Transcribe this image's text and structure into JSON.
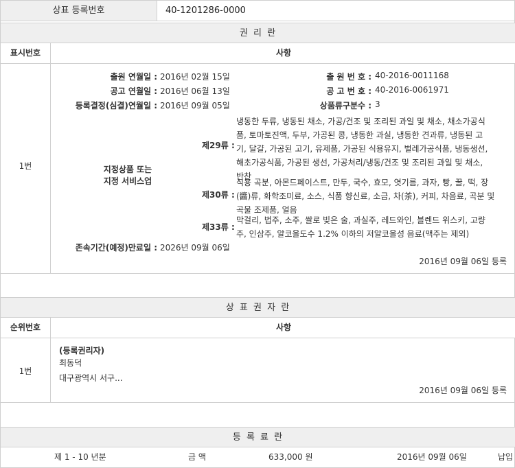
{
  "header": {
    "reg_label": "상표 등록번호",
    "reg_number": "40-1201286-0000"
  },
  "rights_section": {
    "title": "권 리 란",
    "col_number": "표시번호",
    "col_matters": "사항",
    "row_number": "1번",
    "filing_date_label": "출원 연월일 :",
    "filing_date": "2016년 02월 15일",
    "filing_no_label": "출 원 번 호 :",
    "filing_no": "40-2016-0011168",
    "pub_date_label": "공고 연월일 :",
    "pub_date": "2016년 06월 13일",
    "pub_no_label": "공 고 번 호 :",
    "pub_no": "40-2016-0061971",
    "decision_date_label": "등록결정(심결)연월일 :",
    "decision_date": "2016년 09월 05일",
    "class_count_label": "상품류구분수 :",
    "class_count": "3",
    "goods_label_line1": "지정상품 또는",
    "goods_label_line2": "지정 서비스업",
    "classes": [
      {
        "label": "제29류 :",
        "lines": [
          "냉동한 두류, 냉동된 채소, 가공/건조 및 조리된 과일 및 채소, 채소가공식",
          "품, 토마토진액, 두부, 가공된 콩, 냉동한 과실, 냉동한 견과류, 냉동된 고",
          "기, 달걀, 가공된 고기, 유제품, 가공된 식용유지, 벌레가공식품, 냉동생선,",
          "해초가공식품, 가공된 생선, 가공처리/냉동/건조 및 조리된 과일 및 채소,",
          "반찬"
        ]
      },
      {
        "label": "제30류 :",
        "lines": [
          "식용 곡분, 아몬드페이스트, 만두, 국수, 효모, 엿기름, 과자, 빵, 꿀, 떡, 장",
          "(醬)류, 화학조미료, 소스, 식품 향신료, 소금, 차(茶), 커피, 차음료, 곡분 및",
          "곡물 조제품, 얼음"
        ]
      },
      {
        "label": "제33류 :",
        "lines": [
          "막걸리, 법주, 소주, 쌀로 빚은 술, 과실주, 레드와인, 블렌드 위스키, 고량",
          "주, 인삼주, 알코올도수 1.2% 이하의 저알코올성 음료(맥주는 제외)"
        ]
      }
    ],
    "expiry_label": "존속기간(예정)만료일 :",
    "expiry_date": "2026년 09월 06일",
    "registered_note": "2016년 09월 06일 등록"
  },
  "owner_section": {
    "title": "상 표 권 자 란",
    "col_number": "순위번호",
    "col_matters": "사항",
    "row_number": "1번",
    "owner_type": "(등록권리자)",
    "owner_name": "최동덕",
    "owner_address": "대구광역시 서구...",
    "registered_note": "2016년 09월 06일 등록"
  },
  "fee_section": {
    "title": "등 록 료 란",
    "period": "제 1 - 10 년분",
    "amount_label": "금 액",
    "amount": "633,000 원",
    "date": "2016년 09월 06일",
    "status": "납입"
  }
}
